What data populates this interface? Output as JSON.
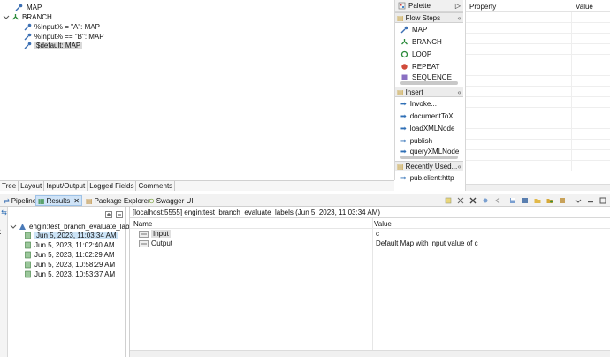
{
  "flow_tree": {
    "items": [
      {
        "label": "MAP",
        "icon": "map-icon"
      },
      {
        "label": "BRANCH",
        "icon": "branch-icon"
      },
      {
        "label": "%Input% = \"A\": MAP",
        "icon": "map-icon"
      },
      {
        "label": "%Input% == \"B\": MAP",
        "icon": "map-icon"
      },
      {
        "label": "$default: MAP",
        "icon": "map-icon",
        "selected": true
      }
    ]
  },
  "palette": {
    "title": "Palette",
    "sections": [
      {
        "title": "Flow Steps",
        "items": [
          "MAP",
          "BRANCH",
          "LOOP",
          "REPEAT",
          "SEQUENCE"
        ]
      },
      {
        "title": "Insert",
        "items": [
          "Invoke...",
          "documentToX...",
          "loadXMLNode",
          "publish",
          "queryXMLNode"
        ]
      },
      {
        "title": "Recently Used...",
        "items": [
          "pub.client:http"
        ]
      }
    ]
  },
  "properties": {
    "col_property": "Property",
    "col_value": "Value"
  },
  "editor_tabs": [
    "Tree",
    "Layout",
    "Input/Output",
    "Logged Fields",
    "Comments"
  ],
  "view_tabs": {
    "pipeline": "Pipeline",
    "results": "Results",
    "package_explorer": "Package Explorer",
    "swagger": "Swagger UI"
  },
  "side_strip_label": "ttle",
  "results": {
    "root": "engin:test_branch_evaluate_labels",
    "runs": [
      "Jun 5, 2023, 11:03:34 AM",
      "Jun 5, 2023, 11:02:40 AM",
      "Jun 5, 2023, 11:02:29 AM",
      "Jun 5, 2023, 10:58:29 AM",
      "Jun 5, 2023, 10:53:37 AM"
    ],
    "title": "[localhost:5555] engin:test_branch_evaluate_labels (Jun 5, 2023, 11:03:34 AM)",
    "col_name": "Name",
    "col_value": "Value",
    "rows": [
      {
        "name": "Input",
        "value": "c"
      },
      {
        "name": "Output",
        "value": "Default Map with input value of c"
      }
    ]
  },
  "colors": {
    "accent": "#2f6fb6",
    "selection": "#cce4f7",
    "map_icon": "#4a7ab8"
  }
}
